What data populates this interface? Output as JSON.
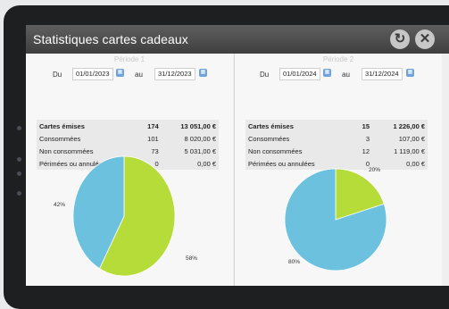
{
  "window": {
    "title": "Statistiques cartes cadeaux"
  },
  "periods": [
    {
      "title": "Période 1",
      "from_label": "Du",
      "from": "01/01/2023",
      "to_label": "au",
      "to": "31/12/2023",
      "rows": [
        {
          "label": "Cartes émises",
          "count": "174",
          "amount": "13 051,00 €"
        },
        {
          "label": "Consommées",
          "count": "101",
          "amount": "8 020,00 €"
        },
        {
          "label": "Non consommées",
          "count": "73",
          "amount": "5 031,00 €"
        },
        {
          "label": "Périmées ou annulées",
          "count": "0",
          "amount": "0,00 €"
        }
      ],
      "pie": {
        "slices": [
          {
            "label": "42%",
            "value": 42,
            "color": "#6bc1de"
          },
          {
            "label": "58%",
            "value": 58,
            "color": "#b6dc3a"
          }
        ]
      }
    },
    {
      "title": "Période 2",
      "from_label": "Du",
      "from": "01/01/2024",
      "to_label": "au",
      "to": "31/12/2024",
      "rows": [
        {
          "label": "Cartes émises",
          "count": "15",
          "amount": "1 226,00 €"
        },
        {
          "label": "Consommées",
          "count": "3",
          "amount": "107,00 €"
        },
        {
          "label": "Non consommées",
          "count": "12",
          "amount": "1 119,00 €"
        },
        {
          "label": "Périmées ou annulées",
          "count": "0",
          "amount": "0,00 €"
        }
      ],
      "pie": {
        "slices": [
          {
            "label": "20%",
            "value": 20,
            "color": "#b6dc3a"
          },
          {
            "label": "80%",
            "value": 80,
            "color": "#6bc1de"
          }
        ]
      }
    }
  ],
  "chart_data": [
    {
      "type": "pie",
      "categories": [
        "42%",
        "58%"
      ],
      "values": [
        42,
        58
      ]
    },
    {
      "type": "pie",
      "categories": [
        "20%",
        "80%"
      ],
      "values": [
        20,
        80
      ]
    }
  ],
  "icons": {
    "refresh": "refresh-icon",
    "close": "close-icon",
    "calendar": "calendar-icon"
  }
}
